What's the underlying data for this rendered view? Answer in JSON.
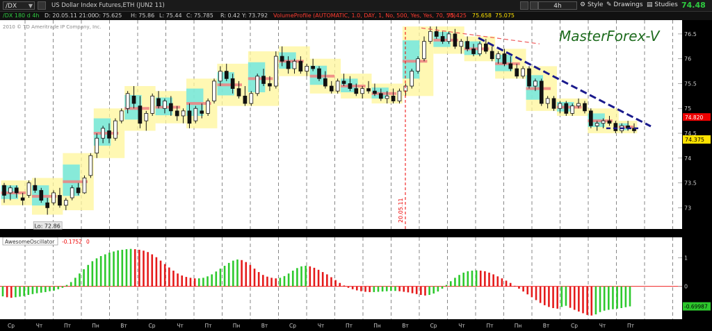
{
  "toolbar": {
    "symbol": "/DX",
    "description": "US Dollar Index Futures,ETH (JUN2 11)",
    "timeframe": "4h",
    "style_label": "Style",
    "drawings_label": "Drawings",
    "studies_label": "Studies",
    "last_price": "74.48"
  },
  "info": {
    "chart_name": "/DX 180 d 4h",
    "date": "D: 20.05.11 21:00",
    "open": "O: 75.625",
    "high": "H: 75.86",
    "low": "L: 75.44",
    "close": "C: 75.785",
    "range": "R: 0.42",
    "y": "Y: 73.792",
    "study": "VolumeProfile (AUTOMATIC, 1.0, DAY, 1, No, 500, Yes, Yes, 70, 50)",
    "vp_value1": "75.425",
    "vp_value2": "75.658",
    "vp_value3": "75.075"
  },
  "chart_data": {
    "type": "candlestick",
    "copyright": "2010 © TD Ameritrade IP Company, Inc.",
    "watermark": "MasterForex-V",
    "y_ticks": [
      "76.5",
      "76",
      "75.5",
      "75",
      "74.5",
      "74",
      "73.5",
      "73"
    ],
    "ylim": [
      72.6,
      76.75
    ],
    "price_labels": {
      "upper": "74.820",
      "current": "74.375"
    },
    "low_label": "Lo: 72.86",
    "date_marker": "20.05.11",
    "candles_ohlc": [
      [
        73.45,
        73.5,
        73.1,
        73.25
      ],
      [
        73.3,
        73.45,
        73.15,
        73.4
      ],
      [
        73.4,
        73.45,
        73.2,
        73.3
      ],
      [
        73.2,
        73.3,
        73.05,
        73.15
      ],
      [
        73.25,
        73.55,
        73.2,
        73.5
      ],
      [
        73.45,
        73.6,
        73.3,
        73.35
      ],
      [
        73.35,
        73.4,
        73.1,
        73.15
      ],
      [
        73.1,
        73.2,
        72.86,
        73.0
      ],
      [
        73.1,
        73.35,
        73.05,
        73.3
      ],
      [
        73.25,
        73.4,
        73.0,
        73.05
      ],
      [
        73.05,
        73.2,
        72.95,
        73.15
      ],
      [
        73.2,
        73.45,
        73.15,
        73.4
      ],
      [
        73.4,
        73.5,
        73.25,
        73.3
      ],
      [
        73.3,
        73.65,
        73.28,
        73.6
      ],
      [
        73.65,
        74.1,
        73.6,
        74.05
      ],
      [
        74.1,
        74.5,
        74.0,
        74.4
      ],
      [
        74.4,
        74.65,
        74.3,
        74.6
      ],
      [
        74.55,
        74.7,
        74.3,
        74.4
      ],
      [
        74.4,
        74.8,
        74.35,
        74.75
      ],
      [
        74.75,
        75.0,
        74.7,
        74.95
      ],
      [
        75.0,
        75.35,
        74.9,
        75.3
      ],
      [
        75.25,
        75.45,
        75.0,
        75.1
      ],
      [
        75.05,
        75.25,
        74.6,
        74.7
      ],
      [
        74.75,
        74.95,
        74.55,
        74.9
      ],
      [
        74.9,
        75.3,
        74.85,
        75.25
      ],
      [
        75.2,
        75.35,
        75.0,
        75.05
      ],
      [
        75.0,
        75.2,
        74.9,
        75.15
      ],
      [
        75.1,
        75.25,
        74.85,
        74.95
      ],
      [
        74.95,
        75.05,
        74.75,
        74.85
      ],
      [
        74.85,
        75.0,
        74.7,
        74.95
      ],
      [
        74.95,
        75.1,
        74.6,
        74.7
      ],
      [
        74.75,
        75.05,
        74.7,
        75.0
      ],
      [
        74.95,
        75.1,
        74.8,
        74.9
      ],
      [
        74.9,
        75.2,
        74.85,
        75.15
      ],
      [
        75.15,
        75.6,
        75.1,
        75.55
      ],
      [
        75.55,
        75.85,
        75.45,
        75.75
      ],
      [
        75.75,
        75.9,
        75.55,
        75.6
      ],
      [
        75.6,
        75.7,
        75.3,
        75.4
      ],
      [
        75.4,
        75.55,
        75.2,
        75.25
      ],
      [
        75.25,
        75.45,
        75.05,
        75.1
      ],
      [
        75.1,
        75.35,
        75.05,
        75.3
      ],
      [
        75.3,
        75.7,
        75.25,
        75.65
      ],
      [
        75.65,
        75.8,
        75.45,
        75.5
      ],
      [
        75.5,
        75.65,
        75.35,
        75.45
      ],
      [
        75.45,
        76.15,
        75.4,
        76.05
      ],
      [
        76.05,
        76.25,
        75.85,
        75.95
      ],
      [
        75.95,
        76.05,
        75.7,
        75.8
      ],
      [
        75.8,
        76.0,
        75.7,
        75.95
      ],
      [
        75.95,
        76.05,
        75.7,
        75.75
      ],
      [
        75.75,
        75.9,
        75.65,
        75.85
      ],
      [
        75.85,
        76.0,
        75.75,
        75.8
      ],
      [
        75.8,
        75.85,
        75.55,
        75.6
      ],
      [
        75.6,
        75.75,
        75.4,
        75.45
      ],
      [
        75.45,
        75.55,
        75.3,
        75.35
      ],
      [
        75.35,
        75.6,
        75.3,
        75.55
      ],
      [
        75.55,
        75.7,
        75.45,
        75.5
      ],
      [
        75.5,
        75.65,
        75.35,
        75.4
      ],
      [
        75.4,
        75.5,
        75.25,
        75.3
      ],
      [
        75.3,
        75.45,
        75.2,
        75.4
      ],
      [
        75.4,
        75.55,
        75.3,
        75.35
      ],
      [
        75.35,
        75.5,
        75.25,
        75.3
      ],
      [
        75.3,
        75.4,
        75.15,
        75.2
      ],
      [
        75.2,
        75.35,
        75.1,
        75.25
      ],
      [
        75.25,
        75.4,
        75.1,
        75.15
      ],
      [
        75.15,
        75.4,
        75.1,
        75.35
      ],
      [
        75.35,
        75.5,
        75.25,
        75.45
      ],
      [
        75.45,
        75.8,
        75.4,
        75.75
      ],
      [
        75.75,
        76.05,
        75.7,
        76.0
      ],
      [
        76.0,
        76.45,
        75.95,
        76.35
      ],
      [
        76.35,
        76.65,
        76.3,
        76.55
      ],
      [
        76.55,
        76.65,
        76.4,
        76.45
      ],
      [
        76.45,
        76.55,
        76.3,
        76.35
      ],
      [
        76.35,
        76.55,
        76.3,
        76.5
      ],
      [
        76.5,
        76.6,
        76.2,
        76.25
      ],
      [
        76.25,
        76.4,
        76.1,
        76.35
      ],
      [
        76.35,
        76.45,
        76.15,
        76.2
      ],
      [
        76.2,
        76.3,
        76.05,
        76.1
      ],
      [
        76.1,
        76.35,
        76.05,
        76.3
      ],
      [
        76.3,
        76.4,
        76.1,
        76.15
      ],
      [
        76.15,
        76.25,
        75.95,
        76.0
      ],
      [
        76.0,
        76.15,
        75.9,
        76.1
      ],
      [
        76.1,
        76.2,
        75.85,
        75.9
      ],
      [
        75.9,
        76.05,
        75.75,
        75.8
      ],
      [
        75.8,
        75.9,
        75.6,
        75.65
      ],
      [
        75.65,
        75.85,
        75.6,
        75.8
      ],
      [
        75.8,
        75.85,
        75.4,
        75.45
      ],
      [
        75.45,
        75.6,
        75.35,
        75.55
      ],
      [
        75.55,
        75.6,
        75.05,
        75.1
      ],
      [
        75.1,
        75.25,
        75.0,
        75.2
      ],
      [
        75.2,
        75.25,
        74.95,
        75.0
      ],
      [
        75.0,
        75.15,
        74.9,
        75.1
      ],
      [
        75.1,
        75.15,
        74.85,
        74.9
      ],
      [
        74.9,
        75.1,
        74.85,
        75.05
      ],
      [
        75.05,
        75.2,
        75.0,
        75.1
      ],
      [
        75.1,
        75.15,
        74.9,
        74.95
      ],
      [
        74.95,
        75.0,
        74.6,
        74.65
      ],
      [
        74.65,
        74.75,
        74.55,
        74.7
      ],
      [
        74.7,
        74.8,
        74.6,
        74.75
      ],
      [
        74.75,
        74.85,
        74.65,
        74.7
      ],
      [
        74.7,
        74.75,
        74.5,
        74.55
      ],
      [
        74.55,
        74.7,
        74.5,
        74.65
      ],
      [
        74.65,
        74.75,
        74.55,
        74.6
      ],
      [
        74.6,
        74.7,
        74.5,
        74.55
      ]
    ],
    "oscillator": {
      "name": "AwesomeOscillator",
      "value_label": "-0.1752",
      "flag": "0",
      "current": "-0.69987",
      "y_ticks": [
        "1",
        "0"
      ],
      "ylim": [
        -1.1,
        1.4
      ],
      "values": [
        -0.35,
        -0.38,
        -0.4,
        -0.38,
        -0.36,
        -0.34,
        -0.3,
        -0.27,
        -0.24,
        -0.22,
        -0.2,
        -0.17,
        -0.15,
        -0.1,
        -0.05,
        0.05,
        0.15,
        0.3,
        0.45,
        0.6,
        0.75,
        0.88,
        0.98,
        1.06,
        1.12,
        1.18,
        1.22,
        1.26,
        1.28,
        1.3,
        1.31,
        1.3,
        1.28,
        1.25,
        1.2,
        1.12,
        1.02,
        0.9,
        0.78,
        0.66,
        0.55,
        0.45,
        0.38,
        0.33,
        0.3,
        0.28,
        0.28,
        0.3,
        0.35,
        0.42,
        0.52,
        0.62,
        0.72,
        0.82,
        0.9,
        0.94,
        0.92,
        0.85,
        0.75,
        0.62,
        0.5,
        0.4,
        0.34,
        0.3,
        0.28,
        0.3,
        0.36,
        0.45,
        0.55,
        0.64,
        0.7,
        0.72,
        0.7,
        0.65,
        0.58,
        0.5,
        0.42,
        0.32,
        0.22,
        0.12,
        0.03,
        -0.05,
        -0.1,
        -0.14,
        -0.17,
        -0.19,
        -0.2,
        -0.2,
        -0.19,
        -0.18,
        -0.17,
        -0.16,
        -0.16,
        -0.17,
        -0.19,
        -0.21,
        -0.24,
        -0.27,
        -0.3,
        -0.32,
        -0.3,
        -0.25,
        -0.18,
        -0.08,
        0.05,
        0.18,
        0.3,
        0.4,
        0.48,
        0.53,
        0.55,
        0.56,
        0.55,
        0.53,
        0.48,
        0.42,
        0.35,
        0.28,
        0.2,
        0.12,
        0.02,
        -0.08,
        -0.18,
        -0.28,
        -0.38,
        -0.48,
        -0.58,
        -0.66,
        -0.72,
        -0.76,
        -0.78,
        -0.72,
        -0.68,
        -0.75,
        -0.82,
        -0.88,
        -0.94,
        -1.0,
        -1.02,
        -0.98,
        -0.9,
        -0.85,
        -0.82,
        -0.8,
        -0.78,
        -0.76,
        -0.73,
        -0.7
      ]
    },
    "x_ticks": [
      "Ср",
      "Чт",
      "Пт",
      "Пн",
      "Вт",
      "Ср",
      "Чт",
      "Пт",
      "Пн",
      "Вт",
      "Ср",
      "Чт",
      "Пт",
      "Пн",
      "Вт",
      "Ср",
      "Чт",
      "Пт",
      "Пн",
      "Вт",
      "Ср",
      "Чт",
      "Пт"
    ]
  }
}
